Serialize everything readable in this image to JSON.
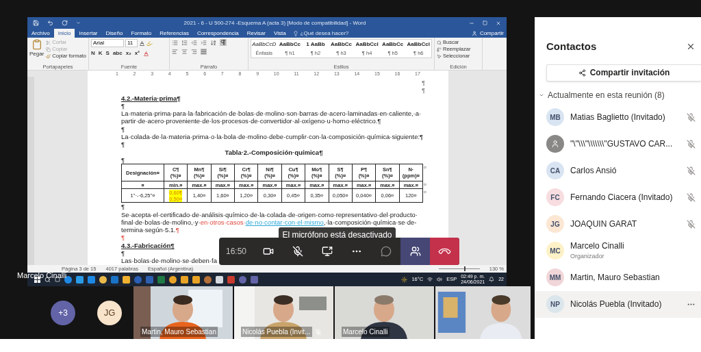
{
  "word": {
    "title": "2021 - 6 - U 500-274 -Esquema A (acta 3) [Modo de compatibilidad] - Word",
    "tabs": [
      {
        "label": "Archivo",
        "selected": false
      },
      {
        "label": "Inicio",
        "selected": true
      },
      {
        "label": "Insertar",
        "selected": false
      },
      {
        "label": "Diseño",
        "selected": false
      },
      {
        "label": "Formato",
        "selected": false
      },
      {
        "label": "Referencias",
        "selected": false
      },
      {
        "label": "Correspondencia",
        "selected": false
      },
      {
        "label": "Revisar",
        "selected": false
      },
      {
        "label": "Vista",
        "selected": false
      }
    ],
    "tell_me": "¿Qué desea hacer?",
    "share": "Compartir",
    "clipboard": {
      "label": "Portapapeles",
      "paste": "Pegar",
      "actions": [
        {
          "text": "Cortar",
          "disabled": true
        },
        {
          "text": "Copiar",
          "disabled": true
        },
        {
          "text": "Copiar formato",
          "disabled": false
        }
      ]
    },
    "font": {
      "label": "Fuente",
      "name": "Arial",
      "size": "11",
      "format_buttons": [
        "N",
        "K",
        "S",
        "abc",
        "x₂",
        "x²"
      ]
    },
    "paragraph": {
      "label": "Párrafo",
      "show_marks": true
    },
    "styles": {
      "label": "Estilos",
      "items": [
        {
          "preview": "AaBbCcD",
          "label": "Énfasis",
          "kind": "italic"
        },
        {
          "preview": "AaBbCc",
          "label": "¶ h1",
          "kind": "bold"
        },
        {
          "preview": "1 AaBb",
          "label": "¶ h2",
          "kind": "bold"
        },
        {
          "preview": "AaBbCc",
          "label": "¶ h3",
          "kind": "bold"
        },
        {
          "preview": "AaBbCcl",
          "label": "¶ h4",
          "kind": "bold"
        },
        {
          "preview": "AaBbCc",
          "label": "¶ h5",
          "kind": "bold"
        },
        {
          "preview": "AaBbCcl",
          "label": "¶ h6",
          "kind": "bold"
        }
      ]
    },
    "editing": {
      "label": "Edición",
      "actions": [
        "Buscar",
        "Reemplazar",
        "Seleccionar"
      ]
    },
    "ruler": [
      "1",
      "2",
      "3",
      "4",
      "5",
      "6",
      "7",
      "8",
      "9",
      "10",
      "11",
      "12",
      "13",
      "14",
      "15",
      "16",
      "17"
    ],
    "document": [
      {
        "kind": "marks",
        "texts": [
          "¶",
          "¶"
        ]
      },
      {
        "kind": "heading",
        "text": "4.2.-Materia·prima¶"
      },
      {
        "kind": "pilcrow",
        "text": "¶",
        "inserted": false
      },
      {
        "kind": "paragraph",
        "lines": [
          "La·materia·prima·para·la·fabricación·de·bolas·de·molino·son·barras·de·acero·laminadas·en·caliente,·a·",
          "partir·de·acero·proveniente·de·los·procesos·de·convertidor·al·oxígeno·u·horno·eléctrico.¶"
        ]
      },
      {
        "kind": "pilcrow",
        "text": "¶",
        "inserted": false
      },
      {
        "kind": "paragraph",
        "lines": [
          "La·colada·de·la·materia·prima·o·la·bola·de·molino·debe·cumplir·con·la·composición·química·siguiente:¶"
        ]
      },
      {
        "kind": "pilcrow",
        "text": "¶",
        "inserted": false
      },
      {
        "kind": "caption",
        "text": "Tabla·2.-Composición·química¶"
      },
      {
        "kind": "pilcrow",
        "text": "¶",
        "inserted": false
      },
      {
        "kind": "table",
        "rows": [
          {
            "header": true,
            "end_mark": "¤",
            "cells": [
              {
                "lines": [
                  "Designación¤"
                ],
                "highlighted": false
              },
              {
                "lines": [
                  "C¶",
                  "(%)¤"
                ],
                "highlighted": false
              },
              {
                "lines": [
                  "Mn¶",
                  "(%)¤"
                ],
                "highlighted": false
              },
              {
                "lines": [
                  "Si¶",
                  "(%)¤"
                ],
                "highlighted": false
              },
              {
                "lines": [
                  "Cr¶",
                  "(%)¤"
                ],
                "highlighted": false
              },
              {
                "lines": [
                  "Ni¶",
                  "(%)¤"
                ],
                "highlighted": false
              },
              {
                "lines": [
                  "Cu¶",
                  "(%)¤"
                ],
                "highlighted": false
              },
              {
                "lines": [
                  "Mo¶",
                  "(%)¤"
                ],
                "highlighted": false
              },
              {
                "lines": [
                  "S¶",
                  "(%)¤"
                ],
                "highlighted": false
              },
              {
                "lines": [
                  "P¶",
                  "(%)¤"
                ],
                "highlighted": false
              },
              {
                "lines": [
                  "Sn¶",
                  "(%)¤"
                ],
                "highlighted": false
              },
              {
                "lines": [
                  "N·",
                  "(ppm)¤"
                ],
                "highlighted": false
              }
            ]
          },
          {
            "header": true,
            "end_mark": "¤",
            "cells": [
              {
                "lines": [
                  "¤"
                ],
                "highlighted": false
              },
              {
                "lines": [
                  "min.¤"
                ],
                "highlighted": false
              },
              {
                "lines": [
                  "max.¤"
                ],
                "highlighted": false
              },
              {
                "lines": [
                  "max.¤"
                ],
                "highlighted": false
              },
              {
                "lines": [
                  "max.¤"
                ],
                "highlighted": false
              },
              {
                "lines": [
                  "max.¤"
                ],
                "highlighted": false
              },
              {
                "lines": [
                  "max.¤"
                ],
                "highlighted": false
              },
              {
                "lines": [
                  "max.¤"
                ],
                "highlighted": false
              },
              {
                "lines": [
                  "max.¤"
                ],
                "highlighted": false
              },
              {
                "lines": [
                  "max.¤"
                ],
                "highlighted": false
              },
              {
                "lines": [
                  "max.¤"
                ],
                "highlighted": false
              },
              {
                "lines": [
                  "max.¤"
                ],
                "highlighted": false
              }
            ]
          },
          {
            "header": false,
            "end_mark": "¤",
            "cells": [
              {
                "lines": [
                  "1\"·-·6,25\"¤"
                ],
                "highlighted": false
              },
              {
                "lines": [
                  "0,60¶",
                  "0,50¤"
                ],
                "highlighted": true
              },
              {
                "lines": [
                  "1,40¤"
                ],
                "highlighted": false
              },
              {
                "lines": [
                  "1,60¤"
                ],
                "highlighted": false
              },
              {
                "lines": [
                  "1,20¤"
                ],
                "highlighted": false
              },
              {
                "lines": [
                  "0,30¤"
                ],
                "highlighted": false
              },
              {
                "lines": [
                  "0,45¤"
                ],
                "highlighted": false
              },
              {
                "lines": [
                  "0,35¤"
                ],
                "highlighted": false
              },
              {
                "lines": [
                  "0,050¤"
                ],
                "highlighted": false
              },
              {
                "lines": [
                  "0,040¤"
                ],
                "highlighted": false
              },
              {
                "lines": [
                  "0,06¤"
                ],
                "highlighted": false
              },
              {
                "lines": [
                  "120¤"
                ],
                "highlighted": false
              }
            ]
          }
        ]
      },
      {
        "kind": "pilcrow",
        "text": "¶",
        "inserted": false
      },
      {
        "kind": "revised",
        "lines": [
          [
            {
              "text": "Se·acepta·el·certificado·de·análisis·químico·de·la·colada·de·origen·como·representativo·del·producto·",
              "kind": "normal"
            }
          ],
          [
            {
              "text": "final·de·bolas·de·molino,·y·",
              "kind": "normal"
            },
            {
              "text": "en·otros·casos·",
              "kind": "inserted"
            },
            {
              "text": "de·no·contar·con·el·mismo",
              "kind": "underlined"
            },
            {
              "text": ",·la·composición·química·se·de-",
              "kind": "normal"
            }
          ],
          [
            {
              "text": "termina·según·5.1.",
              "kind": "normal"
            },
            {
              "text": "¶",
              "kind": "inserted"
            }
          ]
        ]
      },
      {
        "kind": "pilcrow",
        "text": "¶",
        "inserted": true
      },
      {
        "kind": "heading",
        "text": "4.3.-Fabricación¶"
      },
      {
        "kind": "pilcrow",
        "text": "¶",
        "inserted": false
      },
      {
        "kind": "paragraph",
        "lines": [
          "Las·bolas·de·molino·se·deben·fa"
        ]
      }
    ],
    "status_bar": {
      "page": "Página 3 de 15",
      "words": "4017 palabras",
      "language": "Español (Argentina)",
      "zoom": "130 %",
      "level": 0.62
    }
  },
  "taskbar": {
    "weather": "16°C",
    "language": "ESP",
    "time": "02:49 p. m.",
    "date": "24/06/2021",
    "notifications": "22"
  },
  "presenter": "Marcelo Cinalli",
  "call_controls": {
    "timer": "16:50",
    "tooltip": "El micrófono está desactivado",
    "camera_on": true,
    "mic_muted": true,
    "buttons": [
      {
        "kind": "camera",
        "selected": false
      },
      {
        "kind": "mic",
        "selected": false
      },
      {
        "kind": "share",
        "selected": false
      },
      {
        "kind": "more",
        "selected": false
      },
      {
        "kind": "chat",
        "selected": false
      },
      {
        "kind": "people",
        "selected": true
      },
      {
        "kind": "leave",
        "selected": false
      }
    ]
  },
  "gallery": {
    "overflow": "+3",
    "avatar": {
      "initials": "JG",
      "color": "#f8e3cb"
    },
    "tiles": [
      {
        "name": "Martin, Mauro Sebastian",
        "muted": false
      },
      {
        "name": "Nicolás Puebla (Invit...",
        "muted": true
      },
      {
        "name": "Marcelo Cinalli",
        "muted": false
      },
      {
        "muted": false
      }
    ]
  },
  "contacts": {
    "title": "Contactos",
    "share_button": "Compartir invitación",
    "section": {
      "label": "Actualmente en esta reunión (8)",
      "expanded": true
    },
    "participants": [
      {
        "kind": "initials",
        "initials": "MB",
        "name": "Matias Baglietto (Invitado)",
        "color": "#d9e4f2",
        "muted": true,
        "selected": false
      },
      {
        "kind": "generic",
        "name": "\"\\\"\\\\\\\"\\\\\\\\\\\\\\\"GUSTAVO CAR...",
        "color": "#8a8886",
        "muted": true,
        "selected": false
      },
      {
        "kind": "initials",
        "initials": "CA",
        "name": "Carlos Ansió",
        "color": "#d9e4f2",
        "muted": true,
        "selected": false
      },
      {
        "kind": "initials",
        "initials": "FC",
        "name": "Fernando Ciacera (Invitado)",
        "color": "#f7dde0",
        "muted": true,
        "selected": false
      },
      {
        "kind": "initials",
        "initials": "JG",
        "name": "JOAQUIN GARAT",
        "color": "#fbe7d4",
        "muted": true,
        "selected": false
      },
      {
        "kind": "initials",
        "initials": "MC",
        "name": "Marcelo Cinalli",
        "role": "Organizador",
        "color": "#fdf1c7",
        "muted": false,
        "selected": false
      },
      {
        "kind": "initials",
        "initials": "MM",
        "name": "Martin, Mauro Sebastian",
        "color": "#f1d6d9",
        "muted": false,
        "selected": false
      },
      {
        "kind": "initials",
        "initials": "NP",
        "name": "Nicolás Puebla (Invitado)",
        "color": "#dbe5ec",
        "muted": false,
        "selected": true
      }
    ]
  }
}
